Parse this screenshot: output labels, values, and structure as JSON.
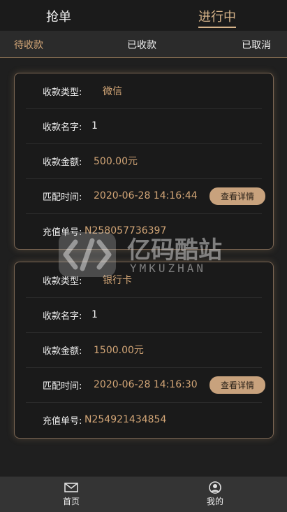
{
  "top_tabs": {
    "grab": "抢单",
    "in_progress": "进行中"
  },
  "sub_tabs": {
    "pending": "待收款",
    "received": "已收款",
    "cancelled": "已取消"
  },
  "cards": [
    {
      "rows": [
        {
          "label": "收款类型:",
          "value": "微信"
        },
        {
          "label": "收款名字:",
          "value": "1"
        },
        {
          "label": "收款金额:",
          "value": "500.00元"
        },
        {
          "label": "匹配时间:",
          "value": "2020-06-28 14:16:44"
        },
        {
          "label": "充值单号:",
          "value": "N258057736397"
        }
      ],
      "button": "查看详情"
    },
    {
      "rows": [
        {
          "label": "收款类型:",
          "value": "银行卡"
        },
        {
          "label": "收款名字:",
          "value": "1"
        },
        {
          "label": "收款金额:",
          "value": "1500.00元"
        },
        {
          "label": "匹配时间:",
          "value": "2020-06-28 14:16:30"
        },
        {
          "label": "充值单号:",
          "value": "N254921434854"
        }
      ],
      "button": "查看详情"
    }
  ],
  "bottom_nav": {
    "home": "首页",
    "me": "我的"
  },
  "watermark": {
    "cn": "亿码酷站",
    "en": "YMKUZHAN"
  },
  "icons": {
    "home": "mail-icon",
    "me": "user-icon"
  }
}
